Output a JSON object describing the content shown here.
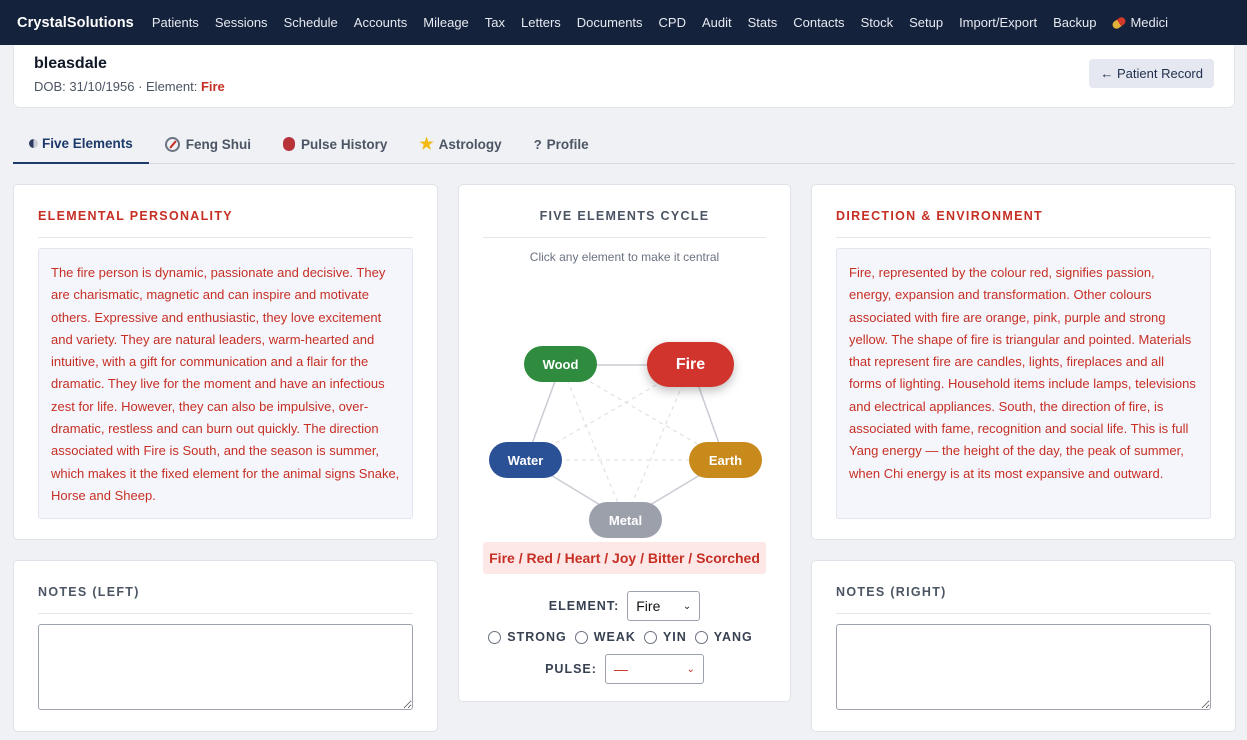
{
  "nav": {
    "brand": "CrystalSolutions",
    "items": [
      "Patients",
      "Sessions",
      "Schedule",
      "Accounts",
      "Mileage",
      "Tax",
      "Letters",
      "Documents",
      "CPD",
      "Audit",
      "Stats",
      "Contacts",
      "Stock",
      "Setup",
      "Import/Export",
      "Backup"
    ],
    "medicine": "Medici",
    "medicine_icon": "pill-icon",
    "bg_color": "#14223c"
  },
  "patient": {
    "name": "bleasdale",
    "dob_text": "DOB: 31/10/1956 · Element: ",
    "element": "Fire",
    "record_button": "← Patient Record"
  },
  "tabs": [
    {
      "label": "Five Elements",
      "icon": "yin-yang-icon",
      "active": true
    },
    {
      "label": "Feng Shui",
      "icon": "compass-icon"
    },
    {
      "label": "Pulse History",
      "icon": "heart-icon"
    },
    {
      "label": "Astrology",
      "icon": "star-icon"
    },
    {
      "label": "Profile",
      "icon": "question-icon",
      "icon_glyph": "?"
    }
  ],
  "left": {
    "title": "ELEMENTAL PERSONALITY",
    "text": "The fire person is dynamic, passionate and decisive. They are charismatic, magnetic and can inspire and motivate others. Expressive and enthusiastic, they love excitement and variety. They are natural leaders, warm-hearted and intuitive, with a gift for communication and a flair for the dramatic. They live for the moment and have an infectious zest for life. However, they can also be impulsive, over-dramatic, restless and can burn out quickly. The direction associated with Fire is South, and the season is summer, which makes it the fixed element for the animal signs Snake, Horse and Sheep."
  },
  "center": {
    "title": "FIVE ELEMENTS CYCLE",
    "hint": "Click any element to make it central",
    "elements": [
      {
        "name": "Wood",
        "color": "#2f8c3e"
      },
      {
        "name": "Fire",
        "color": "#d0342c"
      },
      {
        "name": "Earth",
        "color": "#c98a1c"
      },
      {
        "name": "Metal",
        "color": "#9ca0ab"
      },
      {
        "name": "Water",
        "color": "#2a5196"
      }
    ],
    "summary": "Fire / Red / Heart / Joy / Bitter / Scorched",
    "element_label": "ELEMENT:",
    "element_value": "Fire",
    "radios": [
      "STRONG",
      "WEAK",
      "YIN",
      "YANG"
    ],
    "pulse_label": "PULSE:",
    "pulse_value": "—"
  },
  "right": {
    "title": "DIRECTION & ENVIRONMENT",
    "text": "Fire, represented by the colour red, signifies passion, energy, expansion and transformation. Other colours associated with fire are orange, pink, purple and strong yellow. The shape of fire is triangular and pointed. Materials that represent fire are candles, lights, fireplaces and all forms of lighting. Household items include lamps, televisions and electrical appliances. South, the direction of fire, is associated with fame, recognition and social life. This is full Yang energy — the height of the day, the peak of summer, when Chi energy is at its most expansive and outward."
  },
  "notes": {
    "left_title": "NOTES (LEFT)",
    "right_title": "NOTES (RIGHT)"
  },
  "colors": {
    "accent_red": "#c62f24",
    "nav_bg": "#14223c",
    "active_tab": "#1d3a6b"
  }
}
